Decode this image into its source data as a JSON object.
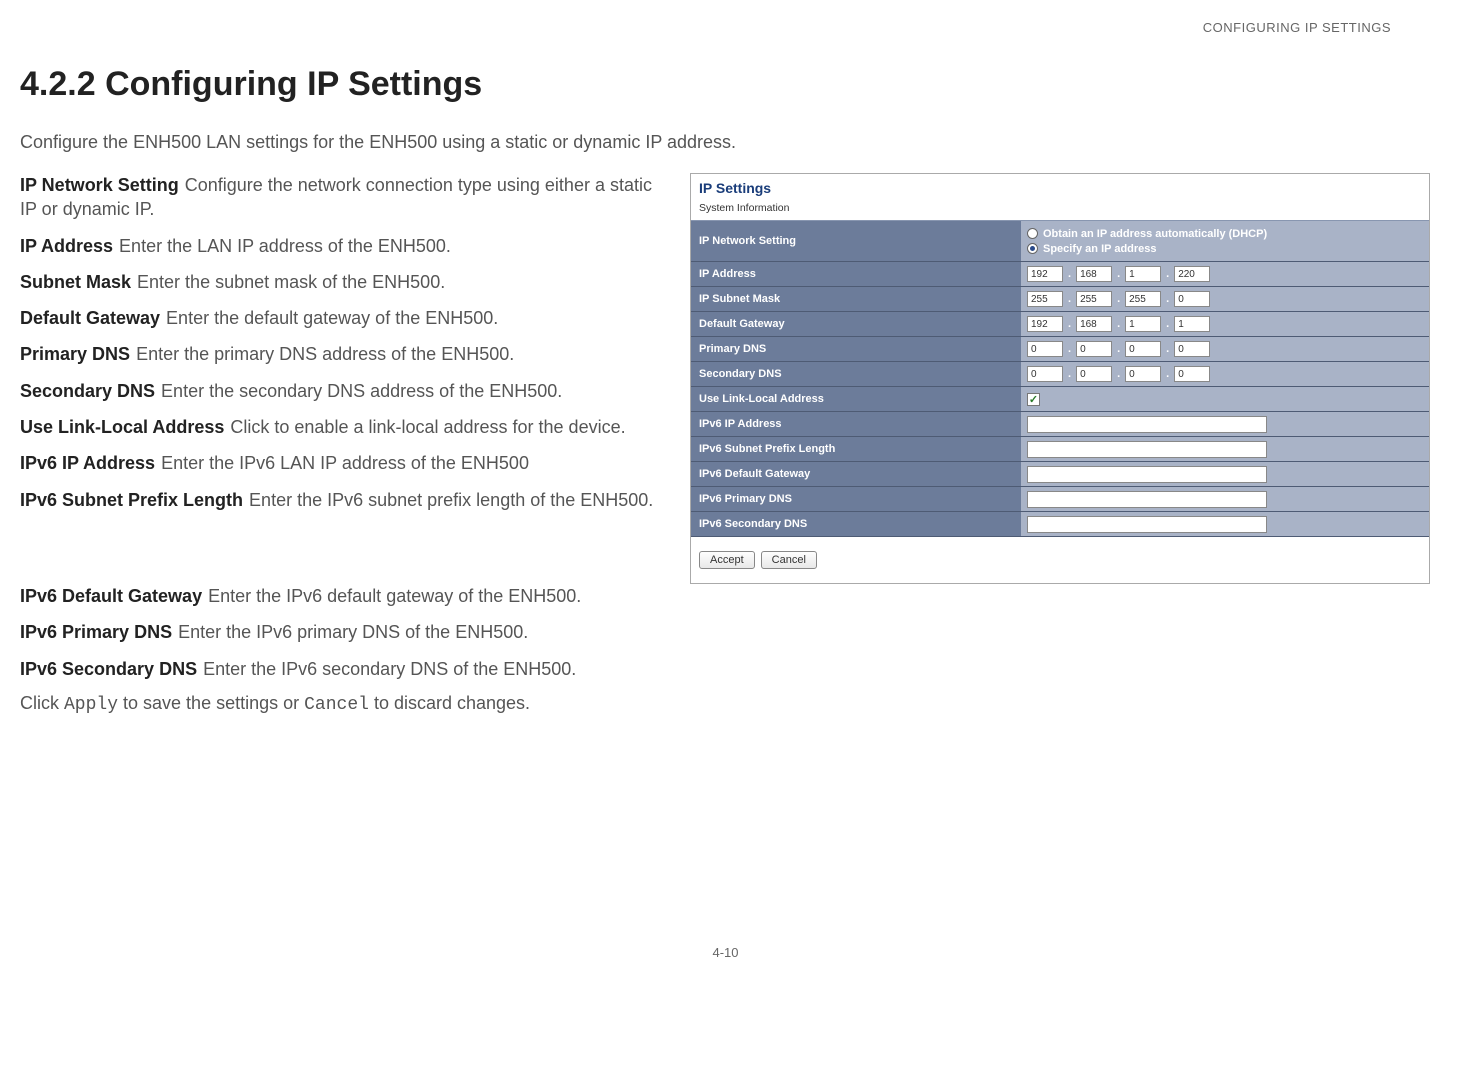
{
  "header": "CONFIGURING IP SETTINGS",
  "heading": "4.2.2 Configuring IP Settings",
  "intro": "Configure the ENH500 LAN settings for the ENH500 using a static or dynamic IP address.",
  "definitions_left": [
    {
      "term": "IP Network Setting",
      "desc": "Configure the network connection type using either a static IP or dynamic IP."
    },
    {
      "term": "IP Address",
      "desc": "Enter the LAN IP address of the ENH500."
    },
    {
      "term": "Subnet Mask",
      "desc": "Enter the subnet mask of the ENH500."
    },
    {
      "term": "Default Gateway",
      "desc": "Enter the default gateway of the ENH500."
    },
    {
      "term": "Primary DNS",
      "desc": "Enter the primary DNS address of the ENH500."
    },
    {
      "term": "Secondary DNS",
      "desc": "Enter the secondary DNS address of the ENH500."
    },
    {
      "term": "Use Link-Local Address",
      "desc": "Click to enable a link-local address for the device."
    },
    {
      "term": "IPv6 IP Address",
      "desc": "Enter the IPv6 LAN IP address of the ENH500"
    },
    {
      "term": "IPv6 Subnet Prefix Length",
      "desc": "Enter the IPv6 subnet prefix length of the ENH500."
    }
  ],
  "definitions_full": [
    {
      "term": "IPv6 Default Gateway",
      "desc": "Enter the IPv6 default gateway of the ENH500."
    },
    {
      "term": "IPv6 Primary DNS",
      "desc": "Enter the IPv6 primary DNS of the ENH500."
    },
    {
      "term": "IPv6 Secondary DNS",
      "desc": "Enter the IPv6 secondary DNS of the ENH500."
    }
  ],
  "closing_pre": "Click ",
  "closing_apply": "Apply",
  "closing_mid": " to save the settings or ",
  "closing_cancel": "Cancel",
  "closing_post": " to discard changes.",
  "screenshot": {
    "title": "IP Settings",
    "subtitle": "System Information",
    "radio1": "Obtain an IP address automatically (DHCP)",
    "radio2": "Specify an IP address",
    "rows": {
      "ip_network_setting": "IP Network Setting",
      "ip_address": "IP Address",
      "ip_subnet_mask": "IP Subnet Mask",
      "default_gateway": "Default Gateway",
      "primary_dns": "Primary DNS",
      "secondary_dns": "Secondary DNS",
      "use_link_local": "Use Link-Local Address",
      "ipv6_ip": "IPv6 IP Address",
      "ipv6_prefix": "IPv6 Subnet Prefix Length",
      "ipv6_gateway": "IPv6 Default Gateway",
      "ipv6_pdns": "IPv6 Primary DNS",
      "ipv6_sdns": "IPv6 Secondary DNS"
    },
    "ip_address_val": [
      "192",
      "168",
      "1",
      "220"
    ],
    "subnet_val": [
      "255",
      "255",
      "255",
      "0"
    ],
    "gateway_val": [
      "192",
      "168",
      "1",
      "1"
    ],
    "pdns_val": [
      "0",
      "0",
      "0",
      "0"
    ],
    "sdns_val": [
      "0",
      "0",
      "0",
      "0"
    ],
    "checkbox_checked": true,
    "btn_accept": "Accept",
    "btn_cancel": "Cancel"
  },
  "footer": "4-10"
}
